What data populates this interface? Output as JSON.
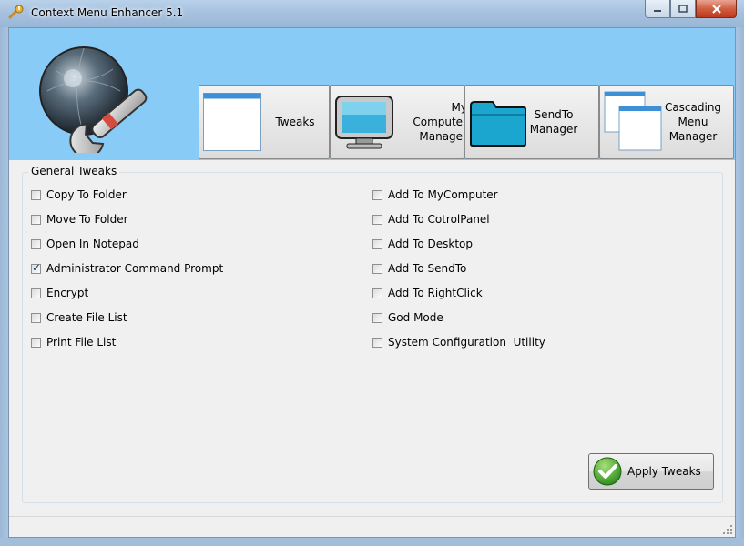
{
  "window": {
    "title": "Context Menu Enhancer 5.1",
    "app_icon": "wrench-icon"
  },
  "tabs": [
    {
      "label": "Tweaks",
      "icon": "blank-window-icon"
    },
    {
      "label": "My\nComputer\nManager",
      "icon": "monitor-icon"
    },
    {
      "label": "SendTo\nManager",
      "icon": "folder-icon"
    },
    {
      "label": "Cascading\nMenu\nManager",
      "icon": "cascading-windows-icon"
    }
  ],
  "group": {
    "title": "General Tweaks",
    "left_options": [
      {
        "label": "Copy To Folder",
        "checked": false
      },
      {
        "label": "Move To Folder",
        "checked": false
      },
      {
        "label": "Open In Notepad",
        "checked": false
      },
      {
        "label": "Administrator Command Prompt",
        "checked": true
      },
      {
        "label": "Encrypt",
        "checked": false
      },
      {
        "label": "Create File List",
        "checked": false
      },
      {
        "label": "Print File List",
        "checked": false
      }
    ],
    "right_options": [
      {
        "label": "Add To MyComputer",
        "checked": false
      },
      {
        "label": "Add To CotrolPanel",
        "checked": false
      },
      {
        "label": "Add To Desktop",
        "checked": false
      },
      {
        "label": "Add To SendTo",
        "checked": false
      },
      {
        "label": "Add To RightClick",
        "checked": false
      },
      {
        "label": "God Mode",
        "checked": false
      },
      {
        "label": "System Configuration  Utility",
        "checked": false
      }
    ]
  },
  "apply": {
    "label": "Apply Tweaks",
    "icon": "green-check-icon"
  },
  "colors": {
    "banner": "#89cbf7",
    "accent_check": "#3fa52a"
  }
}
